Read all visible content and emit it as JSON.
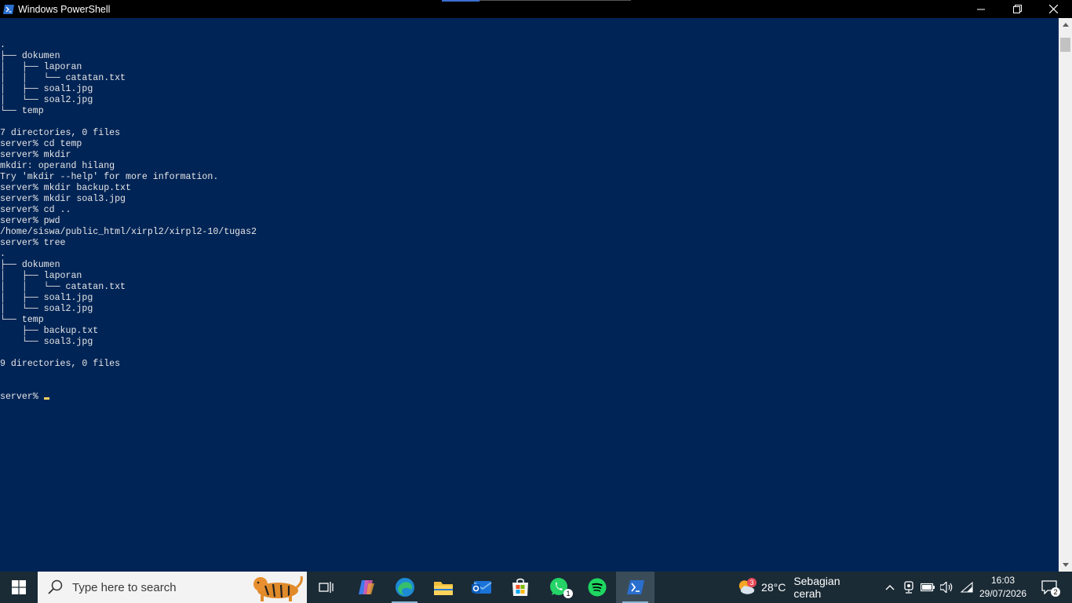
{
  "window": {
    "title": "Windows PowerShell"
  },
  "console": {
    "lines": [
      ".",
      "├── dokumen",
      "│   ├── laporan",
      "│   │   └── catatan.txt",
      "│   ├── soal1.jpg",
      "│   └── soal2.jpg",
      "└── temp",
      "",
      "7 directories, 0 files",
      "server% cd temp",
      "server% mkdir",
      "mkdir: operand hilang",
      "Try 'mkdir --help' for more information.",
      "server% mkdir backup.txt",
      "server% mkdir soal3.jpg",
      "server% cd ..",
      "server% pwd",
      "/home/siswa/public_html/xirpl2/xirpl2-10/tugas2",
      "server% tree",
      ".",
      "├── dokumen",
      "│   ├── laporan",
      "│   │   └── catatan.txt",
      "│   ├── soal1.jpg",
      "│   └── soal2.jpg",
      "└── temp",
      "    ├── backup.txt",
      "    └── soal3.jpg",
      "",
      "9 directories, 0 files"
    ],
    "prompt": "server% "
  },
  "taskbar": {
    "search_placeholder": "Type here to search",
    "weather_temp": "28°C",
    "weather_desc": "Sebagian cerah",
    "weather_badge": "3",
    "whatsapp_badge": "1",
    "time": "16:03",
    "date": "29/07/2026",
    "notification_count": "2"
  },
  "colors": {
    "console_bg": "#012456",
    "console_fg": "#e6e6e6",
    "taskbar_bg": "#1a2b36"
  }
}
